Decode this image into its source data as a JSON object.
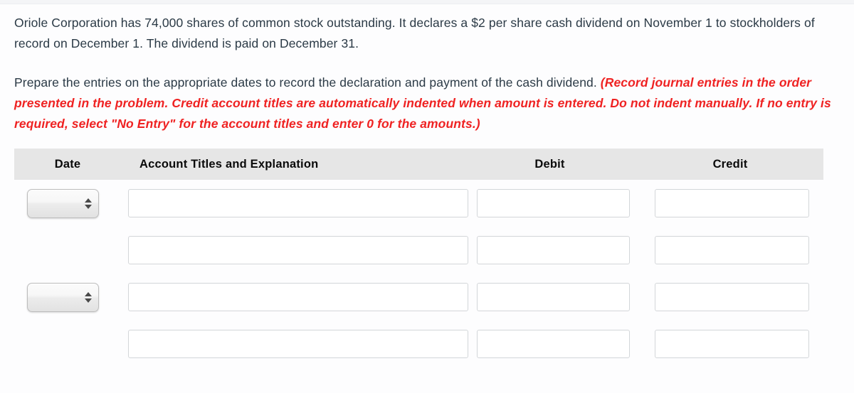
{
  "problem": {
    "paragraph1": "Oriole Corporation has 74,000 shares of common stock outstanding. It declares a $2 per share cash dividend on November 1 to stockholders of record on December 1. The dividend is paid on December 31.",
    "paragraph2_plain": "Prepare the entries on the appropriate dates to record the declaration and payment of the cash dividend. ",
    "paragraph2_emphasis": "(Record journal entries in the order presented in the problem. Credit account titles are automatically indented when amount is entered. Do not indent manually. If no entry is required, select \"No Entry\" for the account titles and enter 0 for the amounts.)"
  },
  "journal": {
    "headers": {
      "date": "Date",
      "account": "Account Titles and Explanation",
      "debit": "Debit",
      "credit": "Credit"
    },
    "rows": [
      {
        "has_date_select": true,
        "date_value": "",
        "date_placeholder": "",
        "account_value": "",
        "account_placeholder": "",
        "debit_value": "",
        "debit_placeholder": "",
        "credit_value": "",
        "credit_placeholder": ""
      },
      {
        "has_date_select": false,
        "date_value": "",
        "date_placeholder": "",
        "account_value": "",
        "account_placeholder": "",
        "debit_value": "",
        "debit_placeholder": "",
        "credit_value": "",
        "credit_placeholder": ""
      },
      {
        "has_date_select": true,
        "date_value": "",
        "date_placeholder": "",
        "account_value": "",
        "account_placeholder": "",
        "debit_value": "",
        "debit_placeholder": "",
        "credit_value": "",
        "credit_placeholder": ""
      },
      {
        "has_date_select": false,
        "date_value": "",
        "date_placeholder": "",
        "account_value": "",
        "account_placeholder": "",
        "debit_value": "",
        "debit_placeholder": "",
        "credit_value": "",
        "credit_placeholder": ""
      }
    ]
  },
  "colors": {
    "emphasis_red": "#ef2222",
    "body_text": "#2b3a46",
    "header_band": "#e6e6e6",
    "input_border": "#d3d6d9"
  }
}
